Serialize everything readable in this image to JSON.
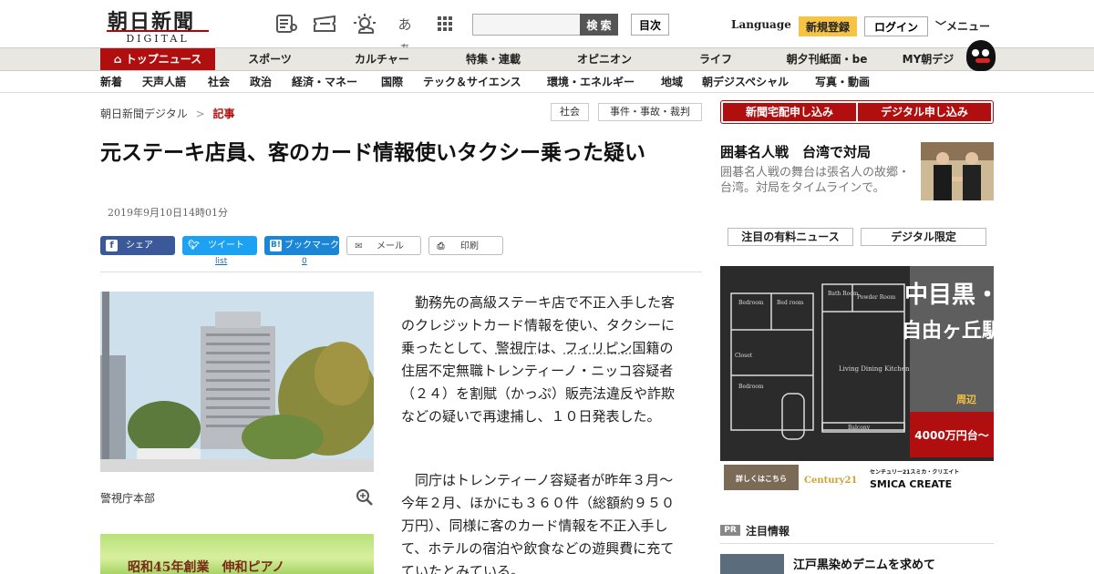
{
  "header": {
    "logo_main": "朝日新聞",
    "logo_sub": "DIGITAL",
    "icons": [
      "newspaper-icon",
      "ticket-icon",
      "weather-icon",
      "font-size-icon",
      "grid-icon"
    ],
    "font_size_label": "あぁ",
    "search": {
      "placeholder": "",
      "button_label": "検 索"
    },
    "index_label": "目次",
    "language_label": "Language",
    "register_label": "新規登録",
    "login_label": "ログイン",
    "menu_label": "メニュー"
  },
  "primary_nav": {
    "top_news": "トップニュース",
    "items": [
      "スポーツ",
      "カルチャー",
      "特集・連載",
      "オピニオン",
      "ライフ",
      "朝夕刊紙面・be",
      "MY朝デジ"
    ]
  },
  "secondary_nav": {
    "items": [
      "新着",
      "天声人語",
      "社会",
      "政治",
      "経済・マネー",
      "国際",
      "テック＆サイエンス",
      "環境・エネルギー",
      "地域",
      "朝デジスペシャル",
      "写真・動画"
    ]
  },
  "breadcrumb": {
    "home": "朝日新聞デジタル",
    "separator": ">",
    "current": "記事"
  },
  "tags": [
    "社会",
    "事件・事故・裁判"
  ],
  "article": {
    "headline": "元ステーキ店員、客のカード情報使いタクシー乗った疑い",
    "timestamp": "2019年9月10日14時01分",
    "share": {
      "facebook": "シェア",
      "twitter": "ツイート",
      "twitter_count": "list",
      "hatena": "ブックマーク",
      "hatena_count": "0",
      "mail": "メール",
      "print": "印刷"
    },
    "photo_caption": "警視庁本部",
    "para1_a": "勤務先の高級ステーキ店で不正入手した客のクレジットカード情報を使い、タクシーに乗ったとして、",
    "para1_kw1": "警視庁",
    "para1_b": "は、",
    "para1_kw2": "フィリピン",
    "para1_c": "国籍の住居不定無職トレンティーノ・ニッコ容疑者（２４）を割賦（かっぷ）販売法違反や詐欺などの疑いで再逮捕し、１０日発表した。",
    "para2": "同庁はトレンティーノ容疑者が昨年３月～今年２月、ほかにも３６０件（総額約９５０万円）、同様に客のカード情報を不正入手して、ホテルの宿泊や飲食などの遊興費に充てていたとみている。",
    "ad_text": "昭和45年創業　伸和ピアノ"
  },
  "sidebar": {
    "subscribe_paper": "新聞宅配申し込み",
    "subscribe_digital": "デジタル申し込み",
    "headline": "囲碁名人戦　台湾で対局",
    "summary": "囲碁名人戦の舞台は張名人の故郷・台湾。対局をタイムラインで。",
    "tab_paid": "注目の有料ニュース",
    "tab_digital": "デジタル限定",
    "ad": {
      "title": "中目黒・自由ヶ丘駅",
      "area_1": "中目黒・",
      "area_2": "自由ヶ丘駅",
      "area_suffix": "周辺",
      "price": "4000万円台～",
      "cta": "詳しくはこちら",
      "brand_logo": "Century21",
      "brand_jp": "センチュリー21スミカ・クリエイト",
      "brand_en": "SMICA CREATE",
      "room_labels": [
        "Bedroom",
        "Bed room",
        "Living Dining Kitchen",
        "Bedroom",
        "Closet",
        "Balcony",
        "Bath Room",
        "Powder Room"
      ]
    },
    "pr_label": "PR",
    "pr_heading": "注目情報",
    "pr_title": "江戸黒染めデニムを求めて"
  }
}
